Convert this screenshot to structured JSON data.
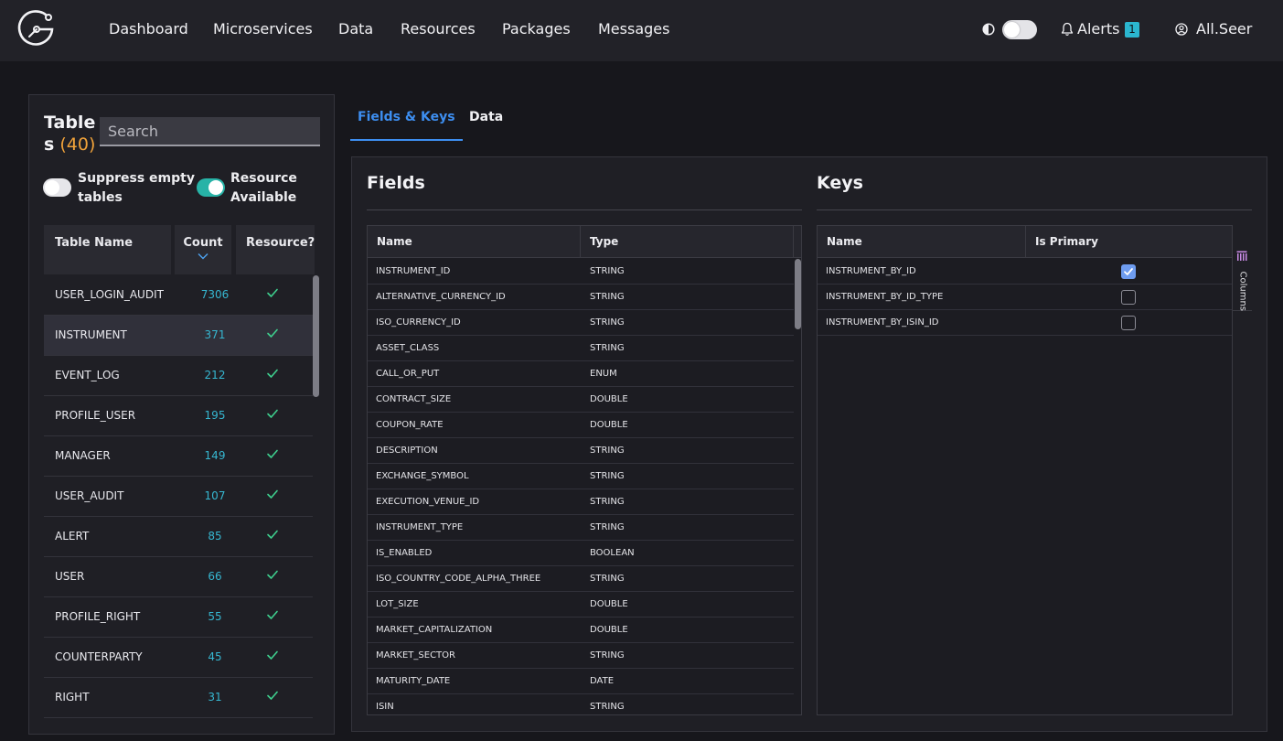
{
  "nav": {
    "items": [
      {
        "label": "Dashboard"
      },
      {
        "label": "Microservices"
      },
      {
        "label": "Data"
      },
      {
        "label": "Resources"
      },
      {
        "label": "Packages"
      },
      {
        "label": "Messages"
      }
    ],
    "alerts_label": "Alerts",
    "alerts_count": "1",
    "user_name": "All.Seer"
  },
  "left": {
    "title": "Table",
    "title_wrap": "s",
    "count_open": " (",
    "count": "40",
    "count_close": ")",
    "search_placeholder": "Search",
    "toggle_suppress": {
      "line1": "Suppress empty",
      "line2": "tables",
      "on": false
    },
    "toggle_resource": {
      "line1": "Resource",
      "line2": "Available",
      "on": true
    },
    "columns": {
      "name": "Table Name",
      "count": "Count",
      "resource": "Resource?"
    },
    "rows": [
      {
        "name": "USER_LOGIN_AUDIT",
        "count": "7306"
      },
      {
        "name": "INSTRUMENT",
        "count": "371"
      },
      {
        "name": "EVENT_LOG",
        "count": "212"
      },
      {
        "name": "PROFILE_USER",
        "count": "195"
      },
      {
        "name": "MANAGER",
        "count": "149"
      },
      {
        "name": "USER_AUDIT",
        "count": "107"
      },
      {
        "name": "ALERT",
        "count": "85"
      },
      {
        "name": "USER",
        "count": "66"
      },
      {
        "name": "PROFILE_RIGHT",
        "count": "55"
      },
      {
        "name": "COUNTERPARTY",
        "count": "45"
      },
      {
        "name": "RIGHT",
        "count": "31"
      }
    ]
  },
  "tabs": [
    {
      "label": "Fields & Keys"
    },
    {
      "label": "Data"
    }
  ],
  "fields": {
    "title": "Fields",
    "columns": {
      "name": "Name",
      "type": "Type"
    },
    "rows": [
      {
        "name": "INSTRUMENT_ID",
        "type": "STRING"
      },
      {
        "name": "ALTERNATIVE_CURRENCY_ID",
        "type": "STRING"
      },
      {
        "name": "ISO_CURRENCY_ID",
        "type": "STRING"
      },
      {
        "name": "ASSET_CLASS",
        "type": "STRING"
      },
      {
        "name": "CALL_OR_PUT",
        "type": "ENUM"
      },
      {
        "name": "CONTRACT_SIZE",
        "type": "DOUBLE"
      },
      {
        "name": "COUPON_RATE",
        "type": "DOUBLE"
      },
      {
        "name": "DESCRIPTION",
        "type": "STRING"
      },
      {
        "name": "EXCHANGE_SYMBOL",
        "type": "STRING"
      },
      {
        "name": "EXECUTION_VENUE_ID",
        "type": "STRING"
      },
      {
        "name": "INSTRUMENT_TYPE",
        "type": "STRING"
      },
      {
        "name": "IS_ENABLED",
        "type": "BOOLEAN"
      },
      {
        "name": "ISO_COUNTRY_CODE_ALPHA_THREE",
        "type": "STRING"
      },
      {
        "name": "LOT_SIZE",
        "type": "DOUBLE"
      },
      {
        "name": "MARKET_CAPITALIZATION",
        "type": "DOUBLE"
      },
      {
        "name": "MARKET_SECTOR",
        "type": "STRING"
      },
      {
        "name": "MATURITY_DATE",
        "type": "DATE"
      },
      {
        "name": "ISIN",
        "type": "STRING"
      }
    ]
  },
  "keys": {
    "title": "Keys",
    "columns": {
      "name": "Name",
      "primary": "Is Primary"
    },
    "rows": [
      {
        "name": "INSTRUMENT_BY_ID",
        "primary": true
      },
      {
        "name": "INSTRUMENT_BY_ID_TYPE",
        "primary": false
      },
      {
        "name": "INSTRUMENT_BY_ISIN_ID",
        "primary": false
      }
    ],
    "columns_tool_label": "Columns"
  },
  "colors": {
    "accent_tab": "#3d8ef0",
    "count_orange": "#f0a23a",
    "count_cyan": "#36b7d1",
    "check_green": "#3ecf8e",
    "checkbox_checked": "#6e9cf0"
  }
}
